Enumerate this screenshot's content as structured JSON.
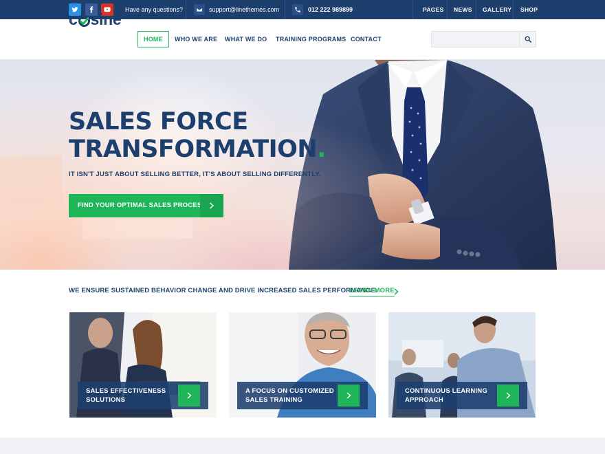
{
  "topbar": {
    "social": [
      {
        "name": "twitter-icon",
        "color": "#2b8fe3"
      },
      {
        "name": "facebook-icon",
        "color": "#3b5a9a"
      },
      {
        "name": "youtube-icon",
        "color": "#d93025"
      }
    ],
    "question": "Have any questions?",
    "email": "support@linethemes.com",
    "phone": "012 222 989899",
    "links": [
      "PAGES",
      "NEWS",
      "GALLERY",
      "SHOP"
    ]
  },
  "header": {
    "logo_prefix": "c",
    "logo_suffix": "sine",
    "nav": [
      "HOME",
      "WHO WE ARE",
      "WHAT WE DO",
      "TRAINING PROGRAMS",
      "CONTACT"
    ],
    "active_nav": "HOME",
    "search_placeholder": ""
  },
  "hero": {
    "title_line1": "SALES FORCE",
    "title_line2": "TRANSFORMATION",
    "title_dot": ".",
    "subtitle": "IT ISN'T JUST ABOUT SELLING BETTER, IT'S ABOUT SELLING DIFFERENTLY.",
    "cta": "FIND YOUR OPTIMAL SALES PROCESS"
  },
  "tagline": {
    "text": "WE ENSURE SUSTAINED BEHAVIOR CHANGE AND DRIVE INCREASED SALES PERFORMANCE.",
    "link": "LEARN MORE"
  },
  "cards": [
    {
      "line1": "SALES EFFECTIVENESS",
      "line2": "SOLUTIONS"
    },
    {
      "line1": "A FOCUS ON CUSTOMIZED",
      "line2": "SALES TRAINING"
    },
    {
      "line1": "CONTINUOUS LEARNING",
      "line2": "APPROACH"
    }
  ],
  "colors": {
    "navy": "#1d3f6e",
    "green": "#1fb65a",
    "bg_light": "#f0f1f4"
  }
}
